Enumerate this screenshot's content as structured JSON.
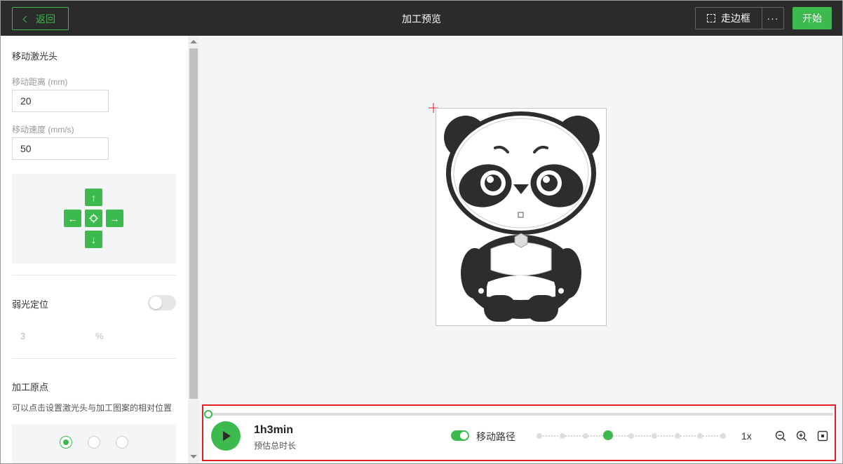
{
  "header": {
    "back_label": "返回",
    "title": "加工预览",
    "frame_label": "走边框",
    "more_label": "···",
    "start_label": "开始"
  },
  "sidebar": {
    "move_title": "移动激光头",
    "distance_label": "移动距离 (mm)",
    "distance_value": "20",
    "speed_label": "移动速度 (mm/s)",
    "speed_value": "50",
    "dpad": {
      "up": "↑",
      "down": "↓",
      "left": "←",
      "right": "→"
    },
    "weak_light_title": "弱光定位",
    "weak_light_enabled": false,
    "weak_light_value": "3",
    "weak_light_unit": "%",
    "origin_title": "加工原点",
    "origin_desc": "可以点击设置激光头与加工图案的相对位置",
    "origin_selected_index": 0
  },
  "player": {
    "progress": 0,
    "duration": "1h3min",
    "duration_label": "预估总时长",
    "move_path_enabled": true,
    "move_path_label": "移动路径",
    "speed_steps": 9,
    "speed_selected_index": 3,
    "speed_label": "1x"
  },
  "colors": {
    "accent": "#3dba4e",
    "header_bg": "#2b2b2b",
    "highlight_border": "#e02020"
  },
  "icons": [
    "chevron-left-icon",
    "dashed-frame-icon",
    "more-icon",
    "crosshair-icon",
    "play-icon",
    "zoom-out-icon",
    "zoom-in-icon",
    "fit-icon",
    "panda-artwork"
  ]
}
